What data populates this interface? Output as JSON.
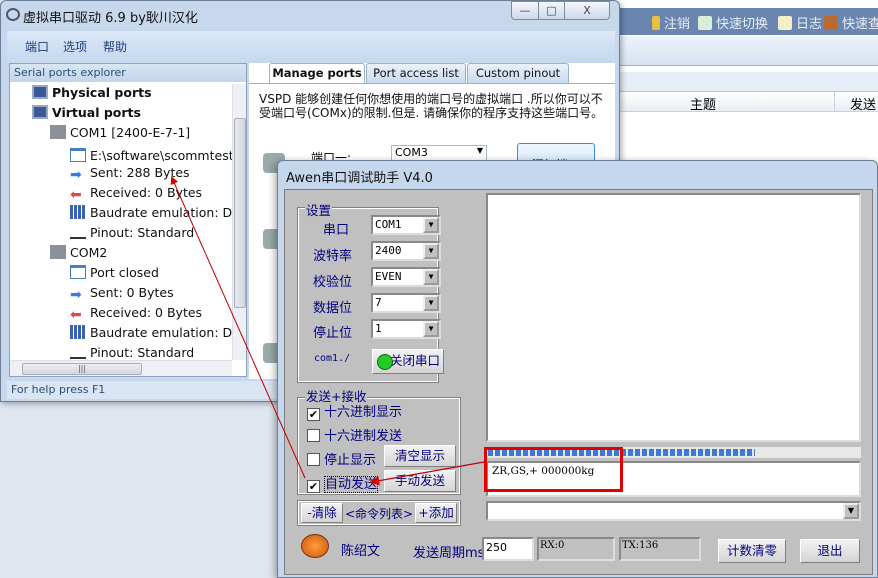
{
  "background_window": {
    "toolbar": [
      {
        "label": "注销",
        "icon": "key-icon"
      },
      {
        "label": "快速切换",
        "icon": "switch-icon"
      },
      {
        "label": "日志",
        "icon": "log-icon"
      },
      {
        "label": "快速查",
        "icon": "users-icon"
      }
    ],
    "columns": [
      "主题",
      "发送"
    ]
  },
  "vspd": {
    "title": "虚拟串口驱动 6.9 by耿川汉化",
    "controls": {
      "minimize": "—",
      "maximize": "□",
      "close": "X"
    },
    "menu": [
      "端口",
      "选项",
      "帮助"
    ],
    "explorer_header": "Serial ports explorer",
    "tree": {
      "physical": "Physical ports",
      "virtual": "Virtual ports",
      "com1": {
        "label": "COM1 [2400-E-7-1]",
        "items": [
          "E:\\software\\scommtest串",
          "Sent: 288 Bytes",
          "Received: 0 Bytes",
          "Baudrate emulation: Dis",
          "Pinout: Standard"
        ]
      },
      "com2": {
        "label": "COM2",
        "items": [
          "Port closed",
          "Sent: 0 Bytes",
          "Received: 0 Bytes",
          "Baudrate emulation: Dis",
          "Pinout: Standard"
        ]
      }
    },
    "status": "For help press F1",
    "tabs": [
      "Manage ports",
      "Port access list",
      "Custom pinout"
    ],
    "active_tab": "Manage ports",
    "description": "VSPD 能够创建任何你想使用的端口号的虚拟端口 .所以你可以不受端口号(COMx)的限制.但是. 请确保你的程序支持这些端口号。",
    "port_one_label": "端口一:",
    "port_one_value": "COM3",
    "add_port_button": "添加端口"
  },
  "awen": {
    "title": "Awen串口调试助手 V4.0",
    "settings": {
      "group_label": "设置",
      "fields": [
        {
          "label": "串口",
          "value": "COM1"
        },
        {
          "label": "波特率",
          "value": "2400"
        },
        {
          "label": "校验位",
          "value": "EVEN"
        },
        {
          "label": "数据位",
          "value": "7"
        },
        {
          "label": "停止位",
          "value": "1"
        }
      ],
      "status_label": "com1./",
      "close_port_button": "关闭串口",
      "port_open_color": "#22cc22"
    },
    "send_receive": {
      "group_label": "发送+接收",
      "hex_display": {
        "label": "十六进制显示",
        "checked": true
      },
      "hex_send": {
        "label": "十六进制发送",
        "checked": false
      },
      "stop_display": {
        "label": "停止显示",
        "checked": false
      },
      "auto_send": {
        "label": "自动发送",
        "checked": true
      },
      "clear_display_button": "清空显示",
      "manual_send_button": "手动发送"
    },
    "commands": {
      "clear": "-清除",
      "list": "<命令列表>",
      "add": "+添加"
    },
    "receive_text": "",
    "send_text": "ZR,GS,+ 000000kg",
    "progress_percent": 72,
    "author": "陈绍文",
    "period_label": "发送周期ms",
    "period_value": "250",
    "rx": "RX:0",
    "tx": "TX:136",
    "reset_count_button": "计数清零",
    "exit_button": "退出",
    "highlight_color": "#e00000"
  }
}
